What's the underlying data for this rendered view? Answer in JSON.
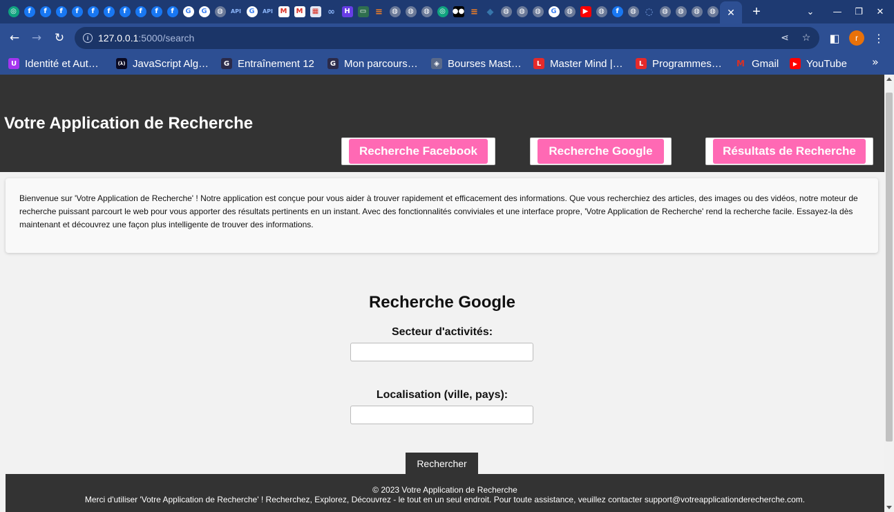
{
  "browser": {
    "tab_favicons": [
      {
        "icon": "chatgpt-icon",
        "glyph": "◎",
        "color": "#10a37f"
      },
      {
        "icon": "facebook-icon",
        "glyph": "f",
        "color": "#1877f2"
      },
      {
        "icon": "facebook-icon",
        "glyph": "f",
        "color": "#1877f2"
      },
      {
        "icon": "facebook-icon",
        "glyph": "f",
        "color": "#1877f2"
      },
      {
        "icon": "facebook-icon",
        "glyph": "f",
        "color": "#1877f2"
      },
      {
        "icon": "facebook-icon",
        "glyph": "f",
        "color": "#1877f2"
      },
      {
        "icon": "facebook-icon",
        "glyph": "f",
        "color": "#1877f2"
      },
      {
        "icon": "facebook-icon",
        "glyph": "f",
        "color": "#1877f2"
      },
      {
        "icon": "facebook-icon",
        "glyph": "f",
        "color": "#1877f2"
      },
      {
        "icon": "facebook-icon",
        "glyph": "f",
        "color": "#1877f2"
      },
      {
        "icon": "facebook-icon",
        "glyph": "f",
        "color": "#1877f2"
      },
      {
        "icon": "google-icon",
        "glyph": "G",
        "color": "#ffffff"
      },
      {
        "icon": "google-icon",
        "glyph": "G",
        "color": "#ffffff"
      },
      {
        "icon": "globe-icon",
        "glyph": "◍",
        "color": "#6b7a99"
      },
      {
        "icon": "api-icon",
        "glyph": "API",
        "color": "transparent"
      },
      {
        "icon": "google-icon",
        "glyph": "G",
        "color": "#ffffff"
      },
      {
        "icon": "api-icon",
        "glyph": "API",
        "color": "transparent"
      },
      {
        "icon": "gmail-icon",
        "glyph": "M",
        "color": "#d93025"
      },
      {
        "icon": "gmail-icon",
        "glyph": "M",
        "color": "#d93025"
      },
      {
        "icon": "calendar-icon",
        "glyph": "▦",
        "color": "#e2e8f5"
      },
      {
        "icon": "link-icon",
        "glyph": "∞",
        "color": "#1e3a72"
      },
      {
        "icon": "hostinger-icon",
        "glyph": "H",
        "color": "#673de6"
      },
      {
        "icon": "chat-icon",
        "glyph": "▭",
        "color": "#2f6f4f"
      },
      {
        "icon": "stackoverflow-icon",
        "glyph": "≡",
        "color": "#f48024"
      },
      {
        "icon": "globe-icon",
        "glyph": "◍",
        "color": "#6b7a99"
      },
      {
        "icon": "globe-icon",
        "glyph": "◍",
        "color": "#6b7a99"
      },
      {
        "icon": "globe-icon",
        "glyph": "◍",
        "color": "#6b7a99"
      },
      {
        "icon": "chatgpt-icon",
        "glyph": "◎",
        "color": "#10a37f"
      },
      {
        "icon": "medium-icon",
        "glyph": "●●",
        "color": "#000000"
      },
      {
        "icon": "stackoverflow-icon",
        "glyph": "≡",
        "color": "#f48024"
      },
      {
        "icon": "python-icon",
        "glyph": "◆",
        "color": "#3776ab"
      },
      {
        "icon": "globe-icon",
        "glyph": "◍",
        "color": "#6b7a99"
      },
      {
        "icon": "globe-icon",
        "glyph": "◍",
        "color": "#6b7a99"
      },
      {
        "icon": "globe-icon",
        "glyph": "◍",
        "color": "#6b7a99"
      },
      {
        "icon": "google-icon",
        "glyph": "G",
        "color": "#ffffff"
      },
      {
        "icon": "globe-icon",
        "glyph": "◍",
        "color": "#6b7a99"
      },
      {
        "icon": "youtube-icon",
        "glyph": "▶",
        "color": "#ff0000"
      },
      {
        "icon": "globe-icon",
        "glyph": "◍",
        "color": "#6b7a99"
      },
      {
        "icon": "facebook-icon",
        "glyph": "f",
        "color": "#1877f2"
      },
      {
        "icon": "globe-icon",
        "glyph": "◍",
        "color": "#6b7a99"
      },
      {
        "icon": "loading-icon",
        "glyph": "◌",
        "color": "#1e3a72"
      },
      {
        "icon": "globe-icon",
        "glyph": "◍",
        "color": "#6b7a99"
      },
      {
        "icon": "globe-icon",
        "glyph": "◍",
        "color": "#6b7a99"
      },
      {
        "icon": "globe-icon",
        "glyph": "◍",
        "color": "#6b7a99"
      },
      {
        "icon": "globe-icon",
        "glyph": "◍",
        "color": "#6b7a99"
      }
    ],
    "url_host": "127.0.0.1",
    "url_path": ":5000/search",
    "avatar_letter": "r",
    "bookmarks": [
      {
        "label": "Identité et Aut…",
        "icon": "udemy-icon",
        "glyph": "U",
        "color": "#a435f0"
      },
      {
        "label": "JavaScript Alg…",
        "icon": "freecodecamp-icon",
        "glyph": "(λ)",
        "color": "#0a0a23"
      },
      {
        "label": "Entraînement 12",
        "icon": "g-icon",
        "glyph": "G",
        "color": "#2b2b4a"
      },
      {
        "label": "Mon parcours…",
        "icon": "g-icon",
        "glyph": "G",
        "color": "#2b2b4a"
      },
      {
        "label": "Bourses Mast…",
        "icon": "tag-icon",
        "glyph": "◈",
        "color": "#5a6a8a"
      },
      {
        "label": "Master Mind |…",
        "icon": "lu-icon",
        "glyph": "L",
        "color": "#e52a2a"
      },
      {
        "label": "Programmes…",
        "icon": "lu-icon",
        "glyph": "L",
        "color": "#e52a2a"
      },
      {
        "label": "Gmail",
        "icon": "gmail-icon",
        "glyph": "M",
        "color": "#d93025"
      },
      {
        "label": "YouTube",
        "icon": "youtube-icon",
        "glyph": "▶",
        "color": "#ff0000"
      }
    ],
    "colors": {
      "tabstrip": "#1e3a72",
      "toolbar": "#2d4f93"
    }
  },
  "site": {
    "title": "Votre Application de Recherche",
    "nav": [
      {
        "label": "Recherche Facebook"
      },
      {
        "label": "Recherche Google"
      },
      {
        "label": "Résultats de Recherche"
      }
    ],
    "intro": "Bienvenue sur 'Votre Application de Recherche' ! Notre application est conçue pour vous aider à trouver rapidement et efficacement des informations. Que vous recherchiez des articles, des images ou des vidéos, notre moteur de recherche puissant parcourt le web pour vous apporter des résultats pertinents en un instant. Avec des fonctionnalités conviviales et une interface propre, 'Votre Application de Recherche' rend la recherche facile. Essayez-la dès maintenant et découvrez une façon plus intelligente de trouver des informations.",
    "colors": {
      "header": "#333333",
      "accent": "#ff69b4"
    }
  },
  "search_form": {
    "title": "Recherche Google",
    "sector_label": "Secteur d'activités:",
    "sector_value": "",
    "location_label": "Localisation (ville, pays):",
    "location_value": "",
    "submit_label": "Rechercher"
  },
  "footer": {
    "copyright": "© 2023 Votre Application de Recherche",
    "message": "Merci d'utiliser 'Votre Application de Recherche' ! Recherchez, Explorez, Découvrez - le tout en un seul endroit. Pour toute assistance, veuillez contacter support@votreapplicationderecherche.com."
  }
}
